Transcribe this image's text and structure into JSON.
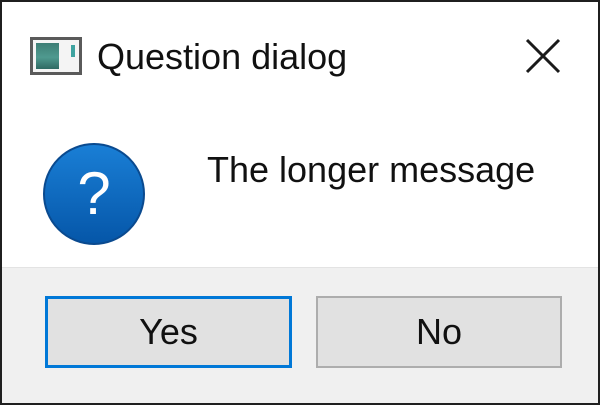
{
  "window": {
    "title": "Question dialog",
    "app_icon": "window-app-icon",
    "close_icon": "close-icon"
  },
  "message": {
    "icon": "question-icon",
    "text": "The longer message",
    "icon_color": "#0063b1"
  },
  "buttons": {
    "yes_label": "Yes",
    "no_label": "No",
    "focus_color": "#0078d7"
  }
}
